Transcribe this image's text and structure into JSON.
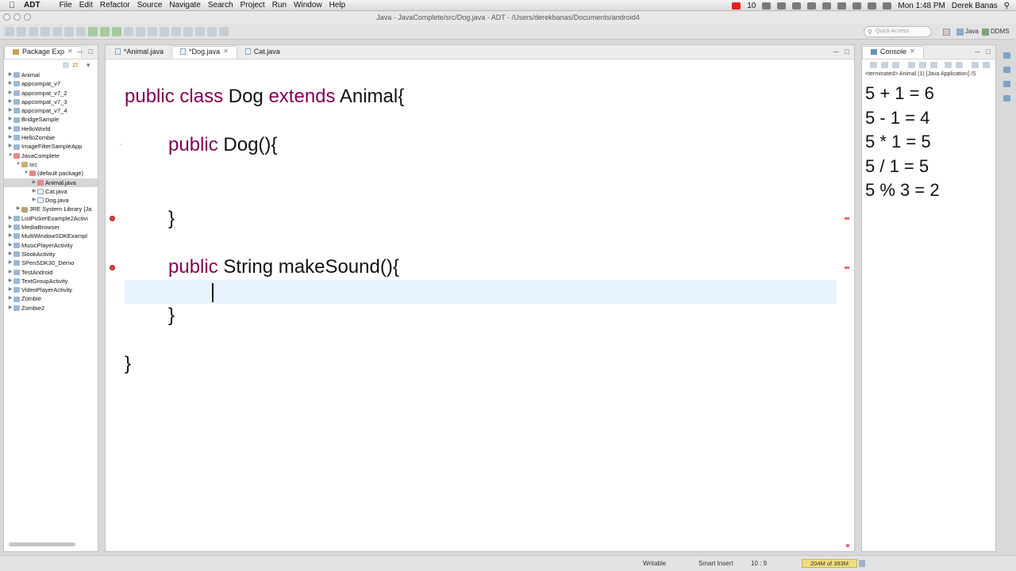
{
  "menubar": {
    "app": "ADT",
    "items": [
      "File",
      "Edit",
      "Refactor",
      "Source",
      "Navigate",
      "Search",
      "Project",
      "Run",
      "Window",
      "Help"
    ],
    "badge_count": "10",
    "clock": "Mon 1:48 PM",
    "user": "Derek Banas"
  },
  "window": {
    "title": "Java - JavaComplete/src/Dog.java - ADT - /Users/derekbanas/Documents/android4"
  },
  "toolbar": {
    "quick_access_placeholder": "Quick Access",
    "perspectives": [
      "Java",
      "DDMS"
    ]
  },
  "package_explorer": {
    "tab_label": "Package Exp",
    "tree": [
      {
        "label": "Animal",
        "depth": 0,
        "arrow": "▶",
        "icon": "project"
      },
      {
        "label": "appcompat_v7",
        "depth": 0,
        "arrow": "▶",
        "icon": "project"
      },
      {
        "label": "appcompat_v7_2",
        "depth": 0,
        "arrow": "▶",
        "icon": "project"
      },
      {
        "label": "appcompat_v7_3",
        "depth": 0,
        "arrow": "▶",
        "icon": "project"
      },
      {
        "label": "appcompat_v7_4",
        "depth": 0,
        "arrow": "▶",
        "icon": "project"
      },
      {
        "label": "BridgeSample",
        "depth": 0,
        "arrow": "▶",
        "icon": "project"
      },
      {
        "label": "HelloWorld",
        "depth": 0,
        "arrow": "▶",
        "icon": "project"
      },
      {
        "label": "HelloZombie",
        "depth": 0,
        "arrow": "▶",
        "icon": "project"
      },
      {
        "label": "ImageFilterSampleApp",
        "depth": 0,
        "arrow": "▶",
        "icon": "project"
      },
      {
        "label": "JavaComplete",
        "depth": 0,
        "arrow": "▼",
        "icon": "err"
      },
      {
        "label": "src",
        "depth": 1,
        "arrow": "▼",
        "icon": "src"
      },
      {
        "label": "(default package)",
        "depth": 2,
        "arrow": "▼",
        "icon": "err"
      },
      {
        "label": "Animal.java",
        "depth": 3,
        "arrow": "▶",
        "icon": "err",
        "selected": true
      },
      {
        "label": "Cat.java",
        "depth": 3,
        "arrow": "▶",
        "icon": "java"
      },
      {
        "label": "Dog.java",
        "depth": 3,
        "arrow": "▶",
        "icon": "java"
      },
      {
        "label": "JRE System Library [Ja",
        "depth": 1,
        "arrow": "▶",
        "icon": "lib"
      },
      {
        "label": "ListPickerExample2Activi",
        "depth": 0,
        "arrow": "▶",
        "icon": "project"
      },
      {
        "label": "MediaBrowser",
        "depth": 0,
        "arrow": "▶",
        "icon": "project"
      },
      {
        "label": "MultiWindowSDKExampl",
        "depth": 0,
        "arrow": "▶",
        "icon": "project"
      },
      {
        "label": "MusicPlayerActivity",
        "depth": 0,
        "arrow": "▶",
        "icon": "project"
      },
      {
        "label": "SlookActivity",
        "depth": 0,
        "arrow": "▶",
        "icon": "project"
      },
      {
        "label": "SPenSDK30_Demo",
        "depth": 0,
        "arrow": "▶",
        "icon": "project"
      },
      {
        "label": "TestAndroid",
        "depth": 0,
        "arrow": "▶",
        "icon": "project"
      },
      {
        "label": "TextGroupActivity",
        "depth": 0,
        "arrow": "▶",
        "icon": "project"
      },
      {
        "label": "VideoPlayerActivity",
        "depth": 0,
        "arrow": "▶",
        "icon": "project"
      },
      {
        "label": "Zombie",
        "depth": 0,
        "arrow": "▶",
        "icon": "project"
      },
      {
        "label": "Zombie2",
        "depth": 0,
        "arrow": "▶",
        "icon": "project"
      }
    ]
  },
  "editor": {
    "tabs": [
      {
        "label": "*Animal.java",
        "active": false
      },
      {
        "label": "*Dog.java",
        "active": true
      },
      {
        "label": "Cat.java",
        "active": false
      }
    ],
    "code": {
      "line1_kw1": "public",
      "line1_kw2": "class",
      "line1_name": "Dog",
      "line1_kw3": "extends",
      "line1_rest": "Animal{",
      "line2_kw": "public",
      "line2_rest": "Dog(){",
      "line3": "}",
      "line4_kw": "public",
      "line4_rest": "String makeSound(){",
      "line5": "}",
      "line6": "}"
    }
  },
  "console": {
    "tab_label": "Console",
    "status": "<terminated> Animal (1) [Java Application] /S",
    "output": [
      "5 + 1 = 6",
      "5 - 1 = 4",
      "5 * 1 = 5",
      "5 / 1 = 5",
      "5 % 3 = 2"
    ]
  },
  "statusbar": {
    "writable": "Writable",
    "insert_mode": "Smart Insert",
    "position": "10 : 9",
    "heap": "204M of 393M"
  }
}
